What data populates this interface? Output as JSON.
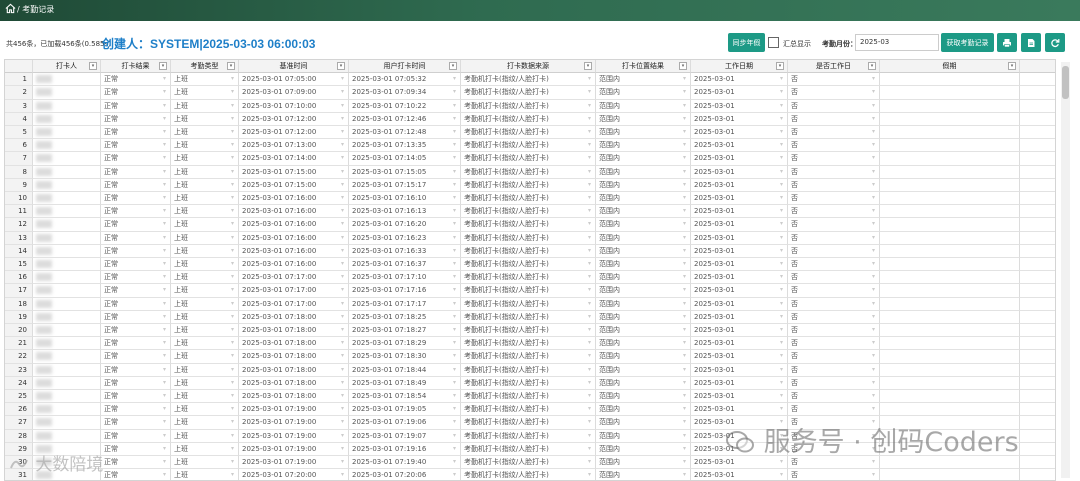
{
  "breadcrumb": {
    "separator": "/",
    "title": "考勤记录"
  },
  "toolbar": {
    "summary": "共456条，已加载456条(0.585s)",
    "creator": "创建人：SYSTEM|2025-03-03 06:00:03",
    "sync_button": "同步年假",
    "summary_toggle_label": "汇总显示",
    "month_label": "考勤月份：",
    "month_value": "2025-03",
    "fetch_button": "获取考勤记录"
  },
  "icons": {
    "home": "home-icon",
    "print": "print-icon",
    "export": "export-file-icon",
    "refresh": "refresh-icon"
  },
  "colors": {
    "topbar": "#2f6b50",
    "button": "#1d9a86",
    "creator": "#1e7fc8"
  },
  "table": {
    "headers": [
      "打卡人",
      "打卡结果",
      "考勤类型",
      "基准时间",
      "用户打卡时间",
      "打卡数据来源",
      "打卡位置结果",
      "工作日期",
      "是否工作日",
      "假期"
    ],
    "rows": [
      [
        "1",
        "",
        "正常",
        "上班",
        "2025-03-01 07:05:00",
        "2025-03-01 07:05:32",
        "考勤机打卡(指纹/人脸打卡)",
        "范围内",
        "2025-03-01",
        "否",
        ""
      ],
      [
        "2",
        "",
        "正常",
        "上班",
        "2025-03-01 07:09:00",
        "2025-03-01 07:09:34",
        "考勤机打卡(指纹/人脸打卡)",
        "范围内",
        "2025-03-01",
        "否",
        ""
      ],
      [
        "3",
        "",
        "正常",
        "上班",
        "2025-03-01 07:10:00",
        "2025-03-01 07:10:22",
        "考勤机打卡(指纹/人脸打卡)",
        "范围内",
        "2025-03-01",
        "否",
        ""
      ],
      [
        "4",
        "",
        "正常",
        "上班",
        "2025-03-01 07:12:00",
        "2025-03-01 07:12:46",
        "考勤机打卡(指纹/人脸打卡)",
        "范围内",
        "2025-03-01",
        "否",
        ""
      ],
      [
        "5",
        "",
        "正常",
        "上班",
        "2025-03-01 07:12:00",
        "2025-03-01 07:12:48",
        "考勤机打卡(指纹/人脸打卡)",
        "范围内",
        "2025-03-01",
        "否",
        ""
      ],
      [
        "6",
        "",
        "正常",
        "上班",
        "2025-03-01 07:13:00",
        "2025-03-01 07:13:35",
        "考勤机打卡(指纹/人脸打卡)",
        "范围内",
        "2025-03-01",
        "否",
        ""
      ],
      [
        "7",
        "",
        "正常",
        "上班",
        "2025-03-01 07:14:00",
        "2025-03-01 07:14:05",
        "考勤机打卡(指纹/人脸打卡)",
        "范围内",
        "2025-03-01",
        "否",
        ""
      ],
      [
        "8",
        "",
        "正常",
        "上班",
        "2025-03-01 07:15:00",
        "2025-03-01 07:15:05",
        "考勤机打卡(指纹/人脸打卡)",
        "范围内",
        "2025-03-01",
        "否",
        ""
      ],
      [
        "9",
        "",
        "正常",
        "上班",
        "2025-03-01 07:15:00",
        "2025-03-01 07:15:17",
        "考勤机打卡(指纹/人脸打卡)",
        "范围内",
        "2025-03-01",
        "否",
        ""
      ],
      [
        "10",
        "",
        "正常",
        "上班",
        "2025-03-01 07:16:00",
        "2025-03-01 07:16:10",
        "考勤机打卡(指纹/人脸打卡)",
        "范围内",
        "2025-03-01",
        "否",
        ""
      ],
      [
        "11",
        "",
        "正常",
        "上班",
        "2025-03-01 07:16:00",
        "2025-03-01 07:16:13",
        "考勤机打卡(指纹/人脸打卡)",
        "范围内",
        "2025-03-01",
        "否",
        ""
      ],
      [
        "12",
        "",
        "正常",
        "上班",
        "2025-03-01 07:16:00",
        "2025-03-01 07:16:20",
        "考勤机打卡(指纹/人脸打卡)",
        "范围内",
        "2025-03-01",
        "否",
        ""
      ],
      [
        "13",
        "",
        "正常",
        "上班",
        "2025-03-01 07:16:00",
        "2025-03-01 07:16:23",
        "考勤机打卡(指纹/人脸打卡)",
        "范围内",
        "2025-03-01",
        "否",
        ""
      ],
      [
        "14",
        "",
        "正常",
        "上班",
        "2025-03-01 07:16:00",
        "2025-03-01 07:16:33",
        "考勤机打卡(指纹/人脸打卡)",
        "范围内",
        "2025-03-01",
        "否",
        ""
      ],
      [
        "15",
        "",
        "正常",
        "上班",
        "2025-03-01 07:16:00",
        "2025-03-01 07:16:37",
        "考勤机打卡(指纹/人脸打卡)",
        "范围内",
        "2025-03-01",
        "否",
        ""
      ],
      [
        "16",
        "",
        "正常",
        "上班",
        "2025-03-01 07:17:00",
        "2025-03-01 07:17:10",
        "考勤机打卡(指纹/人脸打卡)",
        "范围内",
        "2025-03-01",
        "否",
        ""
      ],
      [
        "17",
        "",
        "正常",
        "上班",
        "2025-03-01 07:17:00",
        "2025-03-01 07:17:16",
        "考勤机打卡(指纹/人脸打卡)",
        "范围内",
        "2025-03-01",
        "否",
        ""
      ],
      [
        "18",
        "",
        "正常",
        "上班",
        "2025-03-01 07:17:00",
        "2025-03-01 07:17:17",
        "考勤机打卡(指纹/人脸打卡)",
        "范围内",
        "2025-03-01",
        "否",
        ""
      ],
      [
        "19",
        "",
        "正常",
        "上班",
        "2025-03-01 07:18:00",
        "2025-03-01 07:18:25",
        "考勤机打卡(指纹/人脸打卡)",
        "范围内",
        "2025-03-01",
        "否",
        ""
      ],
      [
        "20",
        "",
        "正常",
        "上班",
        "2025-03-01 07:18:00",
        "2025-03-01 07:18:27",
        "考勤机打卡(指纹/人脸打卡)",
        "范围内",
        "2025-03-01",
        "否",
        ""
      ],
      [
        "21",
        "",
        "正常",
        "上班",
        "2025-03-01 07:18:00",
        "2025-03-01 07:18:29",
        "考勤机打卡(指纹/人脸打卡)",
        "范围内",
        "2025-03-01",
        "否",
        ""
      ],
      [
        "22",
        "",
        "正常",
        "上班",
        "2025-03-01 07:18:00",
        "2025-03-01 07:18:30",
        "考勤机打卡(指纹/人脸打卡)",
        "范围内",
        "2025-03-01",
        "否",
        ""
      ],
      [
        "23",
        "",
        "正常",
        "上班",
        "2025-03-01 07:18:00",
        "2025-03-01 07:18:44",
        "考勤机打卡(指纹/人脸打卡)",
        "范围内",
        "2025-03-01",
        "否",
        ""
      ],
      [
        "24",
        "",
        "正常",
        "上班",
        "2025-03-01 07:18:00",
        "2025-03-01 07:18:49",
        "考勤机打卡(指纹/人脸打卡)",
        "范围内",
        "2025-03-01",
        "否",
        ""
      ],
      [
        "25",
        "",
        "正常",
        "上班",
        "2025-03-01 07:18:00",
        "2025-03-01 07:18:54",
        "考勤机打卡(指纹/人脸打卡)",
        "范围内",
        "2025-03-01",
        "否",
        ""
      ],
      [
        "26",
        "",
        "正常",
        "上班",
        "2025-03-01 07:19:00",
        "2025-03-01 07:19:05",
        "考勤机打卡(指纹/人脸打卡)",
        "范围内",
        "2025-03-01",
        "否",
        ""
      ],
      [
        "27",
        "",
        "正常",
        "上班",
        "2025-03-01 07:19:00",
        "2025-03-01 07:19:06",
        "考勤机打卡(指纹/人脸打卡)",
        "范围内",
        "2025-03-01",
        "否",
        ""
      ],
      [
        "28",
        "",
        "正常",
        "上班",
        "2025-03-01 07:19:00",
        "2025-03-01 07:19:07",
        "考勤机打卡(指纹/人脸打卡)",
        "范围内",
        "2025-03-01",
        "否",
        ""
      ],
      [
        "29",
        "",
        "正常",
        "上班",
        "2025-03-01 07:19:00",
        "2025-03-01 07:19:16",
        "考勤机打卡(指纹/人脸打卡)",
        "范围内",
        "2025-03-01",
        "否",
        ""
      ],
      [
        "30",
        "",
        "正常",
        "上班",
        "2025-03-01 07:19:00",
        "2025-03-01 07:19:40",
        "考勤机打卡(指纹/人脸打卡)",
        "范围内",
        "2025-03-01",
        "否",
        ""
      ],
      [
        "31",
        "",
        "正常",
        "上班",
        "2025-03-01 07:20:00",
        "2025-03-01 07:20:06",
        "考勤机打卡(指纹/人脸打卡)",
        "范围内",
        "2025-03-01",
        "否",
        ""
      ]
    ]
  },
  "watermarks": {
    "right": "服务号 · 创码Coders",
    "left": "大数陪境"
  }
}
